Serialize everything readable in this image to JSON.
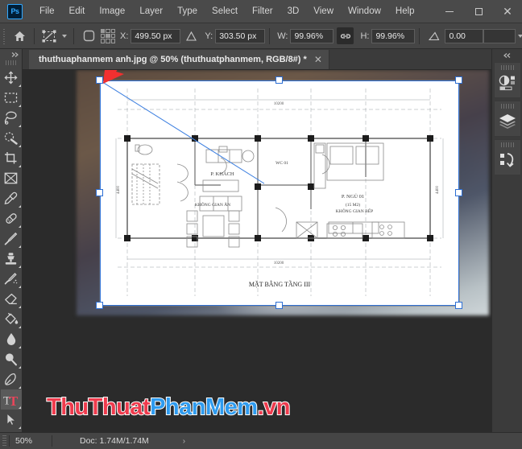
{
  "app": {
    "logo_text": "Ps",
    "menus": [
      "File",
      "Edit",
      "Image",
      "Layer",
      "Type",
      "Select",
      "Filter",
      "3D",
      "View",
      "Window",
      "Help"
    ],
    "window_controls": {
      "minimize": "minimize-icon",
      "maximize": "maximize-icon",
      "close": "close-icon"
    }
  },
  "options_bar": {
    "home_icon": "home-icon",
    "tool_icon": "free-transform-icon",
    "shape_icon": "rounded-square-icon",
    "reference_point_label": "reference-point-grid",
    "x_label": "X:",
    "x_value": "499.50 px",
    "delta_icon": "delta-triangle-icon",
    "y_label": "Y:",
    "y_value": "303.50 px",
    "w_label": "W:",
    "w_value": "99.96%",
    "link_icon": "link-chain-icon",
    "h_label": "H:",
    "h_value": "99.96%",
    "angle_icon": "angle-icon",
    "angle_value": "0.00",
    "share_icon": "share-upload-icon"
  },
  "toolbar": {
    "collapse_icon": "chevrons-right-icon",
    "tools": [
      {
        "name": "move-tool",
        "icon": "move-icon",
        "has_flyout": true
      },
      {
        "name": "rectangular-marquee-tool",
        "icon": "marquee-icon",
        "has_flyout": true
      },
      {
        "name": "lasso-tool",
        "icon": "lasso-icon",
        "has_flyout": true
      },
      {
        "name": "object-selection-tool",
        "icon": "quick-selection-icon",
        "has_flyout": true
      },
      {
        "name": "crop-tool",
        "icon": "crop-icon",
        "has_flyout": true
      },
      {
        "name": "frame-tool",
        "icon": "frame-icon",
        "has_flyout": false
      },
      {
        "name": "eyedropper-tool",
        "icon": "eyedropper-icon",
        "has_flyout": true
      },
      {
        "name": "spot-healing-brush-tool",
        "icon": "healing-brush-icon",
        "has_flyout": true
      },
      {
        "name": "brush-tool",
        "icon": "brush-icon",
        "has_flyout": true
      },
      {
        "name": "clone-stamp-tool",
        "icon": "stamp-icon",
        "has_flyout": true
      },
      {
        "name": "history-brush-tool",
        "icon": "history-brush-icon",
        "has_flyout": true
      },
      {
        "name": "eraser-tool",
        "icon": "eraser-icon",
        "has_flyout": true
      },
      {
        "name": "gradient-tool",
        "icon": "paint-bucket-icon",
        "has_flyout": true
      },
      {
        "name": "blur-tool",
        "icon": "blur-drop-icon",
        "has_flyout": true
      },
      {
        "name": "dodge-tool",
        "icon": "dodge-icon",
        "has_flyout": true
      },
      {
        "name": "pen-tool",
        "icon": "pen-icon",
        "has_flyout": true
      },
      {
        "name": "type-tool",
        "icon": "type-t-icon",
        "has_flyout": true
      },
      {
        "name": "path-selection-tool",
        "icon": "path-arrow-icon",
        "has_flyout": true
      }
    ]
  },
  "document": {
    "tab_title": "thuthuaphanmem anh.jpg @ 50% (thuthuatphanmem, RGB/8#) *",
    "close_icon": "close-icon"
  },
  "canvas": {
    "plan_title": "MẶT BẰNG TẦNG III",
    "rooms": [
      {
        "label": "P. KHÁCH",
        "sub": ""
      },
      {
        "label": "WC 01",
        "sub": ""
      },
      {
        "label": "P. NGỦ 01",
        "sub": "(15 M2)"
      },
      {
        "label": "KHÔNG GIAN ĂN",
        "sub": ""
      },
      {
        "label": "KHÔNG GIAN BẾP",
        "sub": ""
      }
    ],
    "dimensions": {
      "top": "10200",
      "bottom": "10200",
      "left": "4400",
      "right": "4400"
    },
    "annotation_icon": "red-arrow-icon",
    "transform_handles": 8,
    "selection_color": "#2d6fd4"
  },
  "right_dock": {
    "collapse_icon": "chevrons-left-icon",
    "panels": [
      {
        "name": "panel-adjustments",
        "icon": "adjustments-icon"
      },
      {
        "name": "panel-layers",
        "icon": "layers-stack-icon"
      },
      {
        "name": "panel-history",
        "icon": "history-undo-icon"
      }
    ]
  },
  "status_bar": {
    "zoom": "50%",
    "doc_info": "Doc: 1.74M/1.74M",
    "expand_icon": "chevron-right-icon"
  },
  "watermark": {
    "part1": "ThuThuat",
    "part2": "PhanMem",
    "part3": ".vn",
    "color_red": "#ef3b4d",
    "color_blue": "#2e9bef"
  }
}
